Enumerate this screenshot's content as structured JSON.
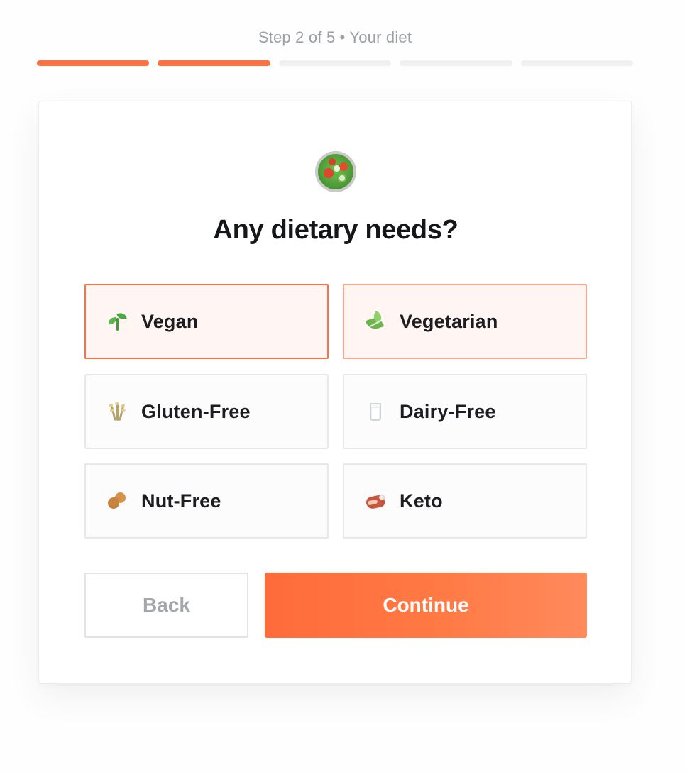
{
  "header": {
    "step_text": "Step 2 of 5",
    "separator": "•",
    "section_text": "Your diet",
    "progress": {
      "current_step": 2,
      "total_steps": 5
    }
  },
  "card": {
    "hero_icon": "green-salad-icon",
    "title": "Any dietary needs?",
    "options": [
      {
        "label": "Vegan",
        "icon": "seedling-icon",
        "selected": true
      },
      {
        "label": "Vegetarian",
        "icon": "leafy-green-icon",
        "selected": true
      },
      {
        "label": "Gluten-Free",
        "icon": "sheaf-of-rice-icon",
        "selected": false
      },
      {
        "label": "Dairy-Free",
        "icon": "glass-of-milk-icon",
        "selected": false
      },
      {
        "label": "Nut-Free",
        "icon": "peanuts-icon",
        "selected": false
      },
      {
        "label": "Keto",
        "icon": "cut-of-meat-icon",
        "selected": false
      }
    ],
    "back_label": "Back",
    "continue_label": "Continue"
  },
  "colors": {
    "accent": "#ff7240",
    "selected_bg": "#fff5f2",
    "text_dark": "#15161a",
    "muted": "#9ca0a6"
  }
}
